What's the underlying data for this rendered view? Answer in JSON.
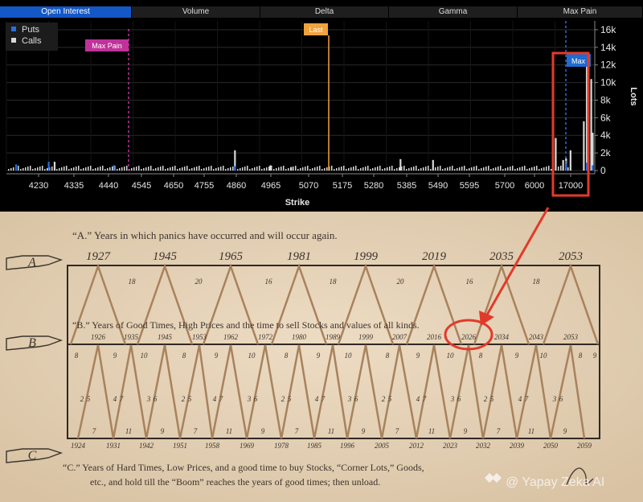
{
  "tabs": [
    {
      "label": "Open Interest",
      "active": true
    },
    {
      "label": "Volume",
      "active": false
    },
    {
      "label": "Delta",
      "active": false
    },
    {
      "label": "Gamma",
      "active": false
    },
    {
      "label": "Max Pain",
      "active": false
    }
  ],
  "colors": {
    "puts": "#2a6de0",
    "calls": "#d8d8d8",
    "max_pain": "#c0329a",
    "last": "#f2a23c",
    "highlight": "#e23a2a",
    "parchment": "#e5d2b7"
  },
  "chart_data": {
    "type": "bar",
    "title": "",
    "legend": [
      {
        "name": "Puts",
        "color": "#2a6de0"
      },
      {
        "name": "Calls",
        "color": "#d8d8d8"
      }
    ],
    "legend_position": "top-left",
    "xlabel": "Strike",
    "ylabel": "Lots",
    "x_ticks": [
      "4230",
      "4335",
      "4440",
      "4545",
      "4650",
      "4755",
      "4860",
      "4965",
      "5070",
      "5175",
      "5280",
      "5385",
      "5490",
      "5595",
      "5700",
      "6000",
      "17000"
    ],
    "y_ticks": [
      "0",
      "2k",
      "4k",
      "6k",
      "8k",
      "10k",
      "12k",
      "14k",
      "16k"
    ],
    "ylim": [
      0,
      17000
    ],
    "grid": true,
    "markers": [
      {
        "label": "Max Pain",
        "strike": 4500,
        "color": "#c0329a"
      },
      {
        "label": "Last",
        "strike": 5125,
        "color": "#f2a23c"
      }
    ],
    "right_marker_label": "Max",
    "series": [
      {
        "name": "Calls",
        "color": "#d8d8d8",
        "x": [
          4310,
          4920,
          5040,
          5110,
          5480,
          5590,
          6005,
          6030,
          6040,
          6055,
          6100,
          6110,
          6125,
          6130
        ],
        "values": [
          1000,
          2300,
          600,
          400,
          1300,
          1200,
          3700,
          1200,
          1400,
          2300,
          5600,
          11800,
          10400,
          4300
        ]
      },
      {
        "name": "Puts",
        "color": "#2a6de0",
        "x": [
          4180,
          4290,
          4510,
          4920,
          6040,
          6110,
          6130
        ],
        "values": [
          700,
          1000,
          600,
          500,
          800,
          900,
          600
        ]
      }
    ]
  },
  "annotation": {
    "callout_label": "Max Pain",
    "last_label": "Last",
    "box_label": "Max"
  },
  "almanac": {
    "line_a": "“A.” Years in which panics have occurred and will occur again.",
    "line_b": "“B.” Years of Good Times, High Prices and the time to sell Stocks and values of all kinds.",
    "line_c1": "“C.”  Years of Hard Times, Low Prices, and a good time to buy Stocks, “Corner Lots,” Goods,",
    "line_c2": "etc., and hold till  the “Boom” reaches the years of good times; then unload.",
    "hand_a": "A",
    "hand_b": "B",
    "hand_c": "C",
    "years_a": [
      "1927",
      "1945",
      "1965",
      "1981",
      "1999",
      "2019",
      "2035",
      "2053"
    ],
    "intervals_a": [
      "18",
      "20",
      "16",
      "18",
      "20",
      "16",
      "18"
    ],
    "years_b": [
      "1926",
      "1935",
      "1945",
      "1953",
      "1962",
      "1972",
      "1980",
      "1989",
      "1999",
      "2007",
      "2016",
      "2026",
      "2034",
      "2043",
      "2053"
    ],
    "years_c": [
      "1924",
      "1931",
      "1942",
      "1951",
      "1958",
      "1969",
      "1978",
      "1985",
      "1996",
      "2005",
      "2012",
      "2023",
      "2032",
      "2039",
      "2050",
      "2059"
    ],
    "highlight_year": "2026",
    "row_top_numbers": [
      "8",
      "9",
      "10",
      "8",
      "9",
      "10",
      "8",
      "9",
      "10",
      "8",
      "9",
      "10",
      "8",
      "9",
      "10",
      "8",
      "9"
    ],
    "row_mid_numbers": [
      "2",
      "5",
      "4",
      "7",
      "3",
      "6",
      "2",
      "5",
      "4",
      "7",
      "3",
      "6",
      "2",
      "5",
      "4",
      "7",
      "3",
      "6",
      "2",
      "5",
      "4",
      "7",
      "3",
      "6",
      "2",
      "5",
      "4",
      "7",
      "3",
      "6"
    ],
    "row_bottom_numbers": [
      "7",
      "11",
      "9",
      "7",
      "11",
      "9",
      "7",
      "11",
      "9",
      "7",
      "11",
      "9",
      "7",
      "11",
      "9"
    ]
  },
  "watermark": "@ Yapay Zeka AI"
}
